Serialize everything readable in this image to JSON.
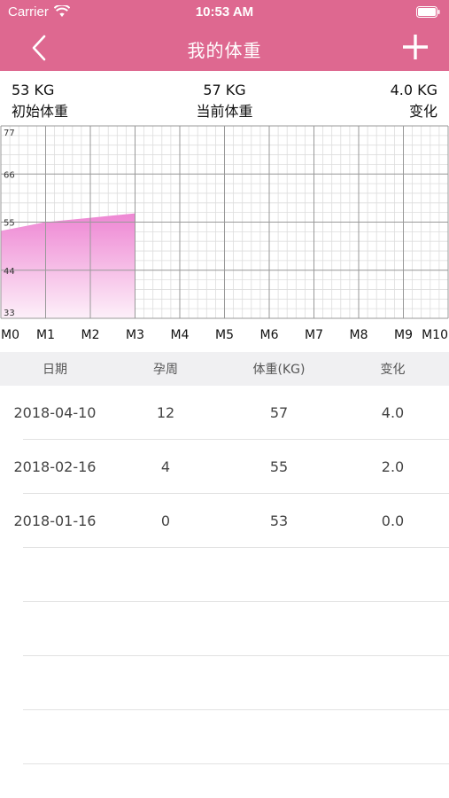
{
  "status_bar": {
    "carrier": "Carrier",
    "time": "10:53 AM",
    "wifi_icon": "wifi-icon",
    "battery_icon": "battery-icon"
  },
  "nav": {
    "title": "我的体重",
    "back_icon": "chevron-left-icon",
    "add_icon": "plus-icon"
  },
  "summary": {
    "initial": {
      "value": "53 KG",
      "label": "初始体重"
    },
    "current": {
      "value": "57 KG",
      "label": "当前体重"
    },
    "change": {
      "value": "4.0 KG",
      "label": "变化"
    }
  },
  "colors": {
    "header": "#de6890",
    "chart_fill_top": "#ee86d3",
    "chart_fill_bottom": "#fbe8f5",
    "grid_major": "#999999",
    "grid_minor": "#dddddd"
  },
  "chart_data": {
    "type": "area",
    "x": [
      "M0",
      "M1",
      "M2",
      "M3"
    ],
    "values": [
      53,
      55,
      56,
      57
    ],
    "x_ticks": [
      "M0",
      "M1",
      "M2",
      "M3",
      "M4",
      "M5",
      "M6",
      "M7",
      "M8",
      "M9",
      "M10"
    ],
    "y_ticks": [
      "33",
      "44",
      "55",
      "66",
      "77"
    ],
    "ylim": [
      33,
      77
    ],
    "xlim": [
      0,
      10
    ],
    "grid": true
  },
  "table": {
    "headers": [
      "日期",
      "孕周",
      "体重(KG)",
      "变化"
    ],
    "rows": [
      [
        "2018-04-10",
        "12",
        "57",
        "4.0"
      ],
      [
        "2018-02-16",
        "4",
        "55",
        "2.0"
      ],
      [
        "2018-01-16",
        "0",
        "53",
        "0.0"
      ]
    ]
  }
}
